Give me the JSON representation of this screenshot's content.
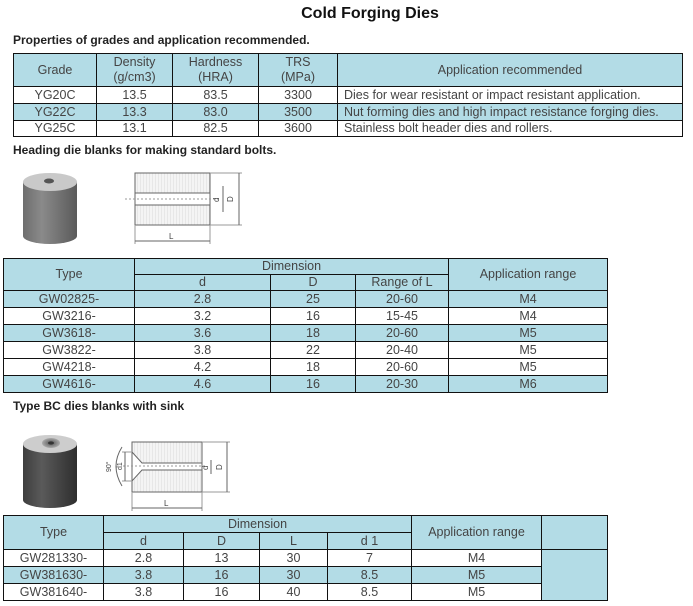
{
  "title": "Cold Forging Dies",
  "section1": {
    "heading": "Properties of grades and application recommended.",
    "headers": {
      "grade": "Grade",
      "density": [
        "Density",
        "(g/cm3)"
      ],
      "hardness": [
        "Hardness",
        "(HRA)"
      ],
      "trs": [
        "TRS",
        "(MPa)"
      ],
      "application": "Application recommended"
    },
    "rows": [
      {
        "grade": "YG20C",
        "density": "13.5",
        "hardness": "83.5",
        "trs": "3300",
        "application": "Dies for wear resistant or impact resistant application."
      },
      {
        "grade": "YG22C",
        "density": "13.3",
        "hardness": "83.0",
        "trs": "3500",
        "application": "Nut forming dies and high impact resistance forging dies."
      },
      {
        "grade": "YG25C",
        "density": "13.1",
        "hardness": "82.5",
        "trs": "3600",
        "application": "Stainless bolt header dies and rollers."
      }
    ]
  },
  "section2": {
    "heading": "Heading die blanks for making standard bolts.",
    "diagram_labels": {
      "d": "d",
      "D": "D",
      "L": "L"
    },
    "headers": {
      "type": "Type",
      "dimension": "Dimension",
      "d": "d",
      "D": "D",
      "range_l": "Range of L",
      "application": "Application range"
    },
    "rows": [
      {
        "type": "GW02825-",
        "d": "2.8",
        "D": "25",
        "range_l": "20-60",
        "application": "M4"
      },
      {
        "type": "GW3216-",
        "d": "3.2",
        "D": "16",
        "range_l": "15-45",
        "application": "M4"
      },
      {
        "type": "GW3618-",
        "d": "3.6",
        "D": "18",
        "range_l": "20-60",
        "application": "M5"
      },
      {
        "type": "GW3822-",
        "d": "3.8",
        "D": "22",
        "range_l": "20-40",
        "application": "M5"
      },
      {
        "type": "GW4218-",
        "d": "4.2",
        "D": "18",
        "range_l": "20-60",
        "application": "M5"
      },
      {
        "type": "GW4616-",
        "d": "4.6",
        "D": "16",
        "range_l": "20-30",
        "application": "M6"
      }
    ]
  },
  "section3": {
    "heading": "Type BC dies blanks with sink",
    "diagram_labels": {
      "angle": "90°",
      "d1": "d1",
      "d": "d",
      "D": "D",
      "L": "L"
    },
    "headers": {
      "type": "Type",
      "dimension": "Dimension",
      "d": "d",
      "D": "D",
      "L": "L",
      "d1": "d 1",
      "application": "Application range"
    },
    "rows": [
      {
        "type": "GW281330-",
        "d": "2.8",
        "D": "13",
        "L": "30",
        "d1": "7",
        "application": "M4"
      },
      {
        "type": "GW381630-",
        "d": "3.8",
        "D": "16",
        "L": "30",
        "d1": "8.5",
        "application": "M5"
      },
      {
        "type": "GW381640-",
        "d": "3.8",
        "D": "16",
        "L": "40",
        "d1": "8.5",
        "application": "M5"
      }
    ]
  },
  "colors": {
    "header_bg": "#b3dce6",
    "border": "#111111"
  }
}
